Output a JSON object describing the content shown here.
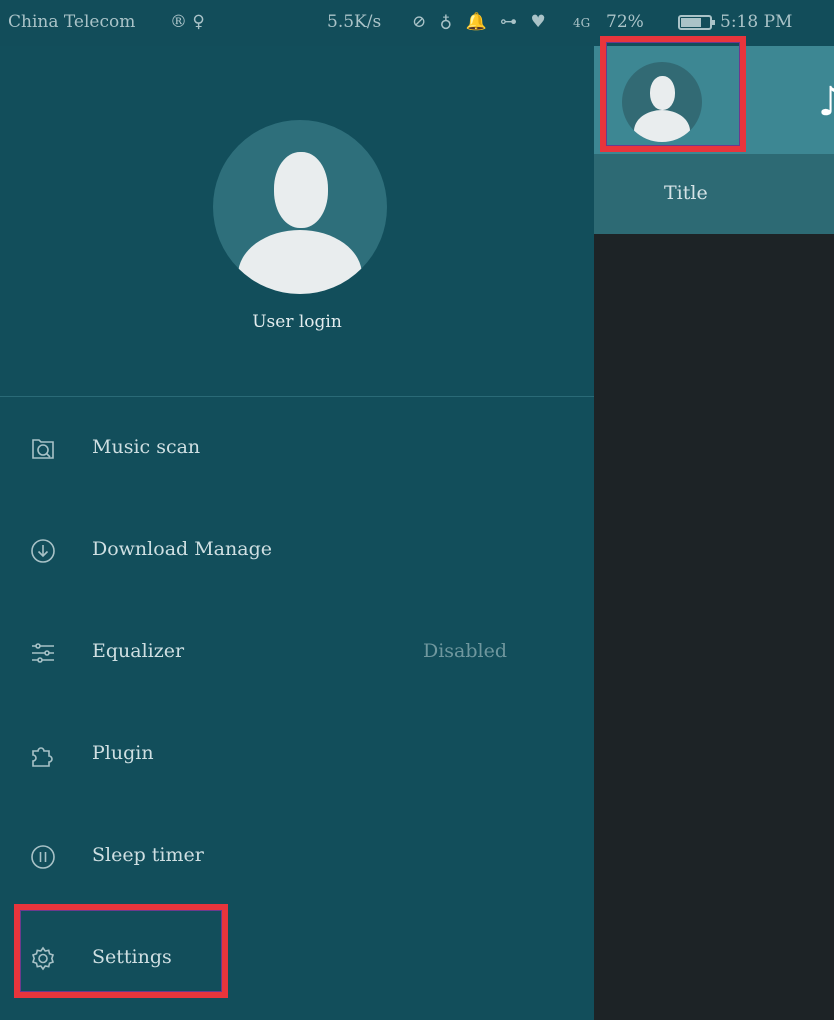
{
  "status_bar": {
    "carrier": "China Telecom",
    "carrier_icons": "® ♀",
    "network_speed": "5.5K/s",
    "system_icons": "⊘ ♁ 🔔 ⊶ ♥",
    "network_type": "4G",
    "battery_percent": "72%",
    "battery_level": 0.72,
    "time": "5:18 PM"
  },
  "drawer": {
    "user_login_label": "User login",
    "menu_items": [
      {
        "label": "Music scan",
        "icon": "music-scan-icon"
      },
      {
        "label": "Download Manage",
        "icon": "download-icon"
      },
      {
        "label": "Equalizer",
        "icon": "equalizer-icon",
        "status": "Disabled"
      },
      {
        "label": "Plugin",
        "icon": "puzzle-icon"
      },
      {
        "label": "Sleep timer",
        "icon": "sleep-timer-icon"
      },
      {
        "label": "Settings",
        "icon": "gear-icon"
      }
    ]
  },
  "main": {
    "header_icon": "music-note-icon",
    "tab_title": "Title"
  },
  "colors": {
    "drawer_bg": "#124e5b",
    "header_bg": "#3d8793",
    "highlight": "#e8353c"
  }
}
